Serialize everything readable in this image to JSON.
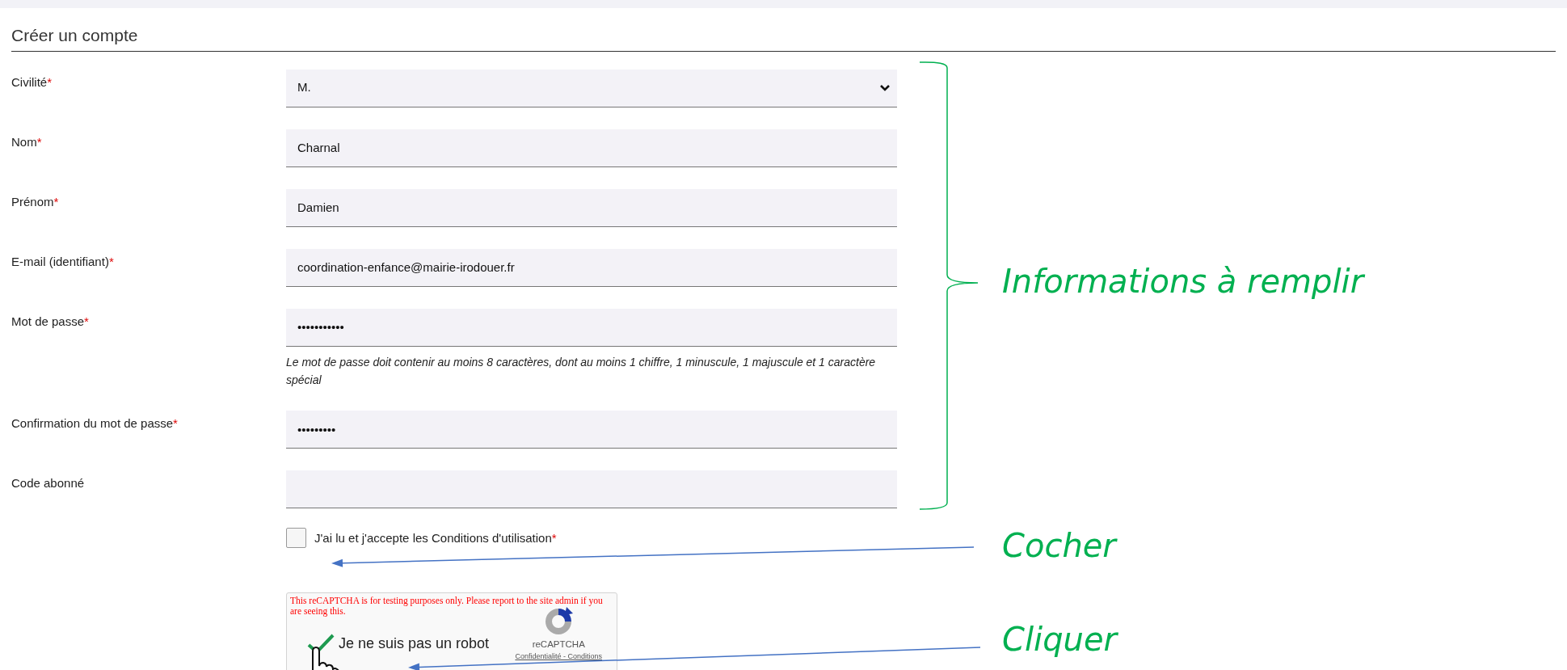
{
  "title": "Créer un compte",
  "required_mark": "*",
  "fields": [
    {
      "kind": "select",
      "label": "Civilité",
      "required": true,
      "value": "M."
    },
    {
      "kind": "text",
      "label": "Nom",
      "required": true,
      "value": "Charnal"
    },
    {
      "kind": "text",
      "label": "Prénom",
      "required": true,
      "value": "Damien"
    },
    {
      "kind": "text",
      "label": "E-mail (identifiant)",
      "required": true,
      "value": "coordination-enfance@mairie-irodouer.fr"
    },
    {
      "kind": "text",
      "label": "Mot de passe",
      "required": true,
      "value": "•••••••••••",
      "help": "Le mot de passe doit contenir au moins 8 caractères, dont au moins 1 chiffre, 1 minuscule, 1 majuscule et 1 caractère spécial"
    },
    {
      "kind": "text",
      "label": "Confirmation du mot de passe",
      "required": true,
      "value": "•••••••••"
    },
    {
      "kind": "text",
      "label": "Code abonné",
      "required": false
    }
  ],
  "terms": {
    "label": "J'ai lu et j'accepte les Conditions d'utilisation",
    "required": true,
    "checked": false
  },
  "recaptcha": {
    "warning": "This reCAPTCHA is for testing purposes only. Please report to the site admin if you are seeing this.",
    "label": "Je ne suis pas un robot",
    "checked": true,
    "brand": "reCAPTCHA",
    "links": "Confidentialité - Conditions"
  },
  "annotations": [
    {
      "kind": "brace",
      "text": "Informations à remplir"
    },
    {
      "kind": "arrow",
      "text": "Cocher"
    },
    {
      "kind": "arrow",
      "text": "Cliquer"
    }
  ]
}
